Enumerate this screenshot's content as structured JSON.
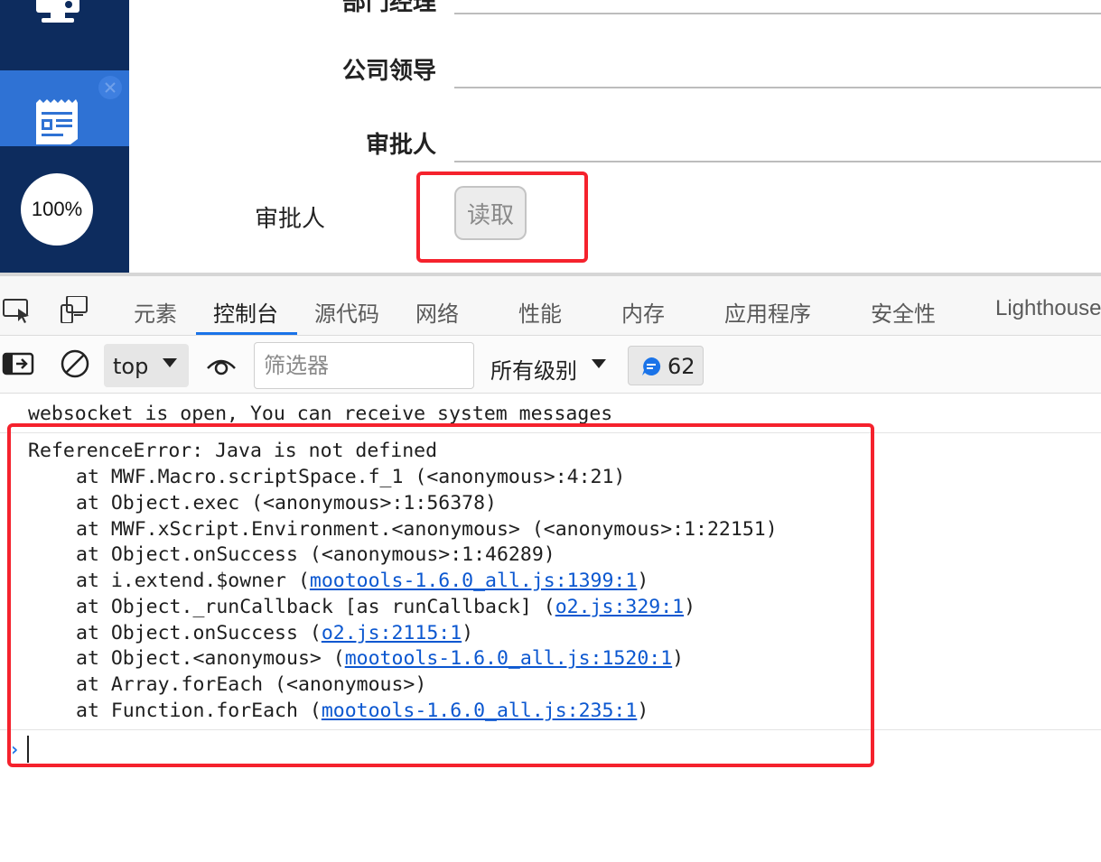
{
  "sidebar": {
    "zoom_label": "100%"
  },
  "form": {
    "rows": [
      {
        "label": "部门经理"
      },
      {
        "label": "公司领导"
      },
      {
        "label": "审批人"
      }
    ],
    "approver_label": "审批人",
    "read_button_label": "读取"
  },
  "devtools": {
    "tabs": [
      {
        "label": "元素"
      },
      {
        "label": "控制台",
        "active": true
      },
      {
        "label": "源代码"
      },
      {
        "label": "网络"
      },
      {
        "label": "性能"
      },
      {
        "label": "内存"
      },
      {
        "label": "应用程序"
      },
      {
        "label": "安全性"
      },
      {
        "label": "Lighthouse"
      }
    ],
    "toolbar": {
      "context_value": "top",
      "filter_placeholder": "筛选器",
      "levels_label": "所有级别",
      "message_count": "62"
    },
    "console": {
      "info_message": "websocket is open, You can receive system messages",
      "error_title": "ReferenceError: Java is not defined",
      "stack": [
        {
          "prefix": "at MWF.Macro.scriptSpace.f_1 (<anonymous>:4:21)",
          "link": "",
          "suffix": ""
        },
        {
          "prefix": "at Object.exec (<anonymous>:1:56378)",
          "link": "",
          "suffix": ""
        },
        {
          "prefix": "at MWF.xScript.Environment.<anonymous> (<anonymous>:1:22151)",
          "link": "",
          "suffix": ""
        },
        {
          "prefix": "at Object.onSuccess (<anonymous>:1:46289)",
          "link": "",
          "suffix": ""
        },
        {
          "prefix": "at i.extend.$owner (",
          "link": "mootools-1.6.0_all.js:1399:1",
          "suffix": ")"
        },
        {
          "prefix": "at Object._runCallback [as runCallback] (",
          "link": "o2.js:329:1",
          "suffix": ")"
        },
        {
          "prefix": "at Object.onSuccess (",
          "link": "o2.js:2115:1",
          "suffix": ")"
        },
        {
          "prefix": "at Object.<anonymous> (",
          "link": "mootools-1.6.0_all.js:1520:1",
          "suffix": ")"
        },
        {
          "prefix": "at Array.forEach (<anonymous>)",
          "link": "",
          "suffix": ""
        },
        {
          "prefix": "at Function.forEach (",
          "link": "mootools-1.6.0_all.js:235:1",
          "suffix": ")"
        }
      ]
    }
  },
  "colors": {
    "sidebar_bg": "#0d2c5e",
    "sidebar_active": "#2f72d4",
    "highlight_red": "#f5222d",
    "link_blue": "#0b57d0",
    "tab_active_underline": "#1a73e8"
  }
}
